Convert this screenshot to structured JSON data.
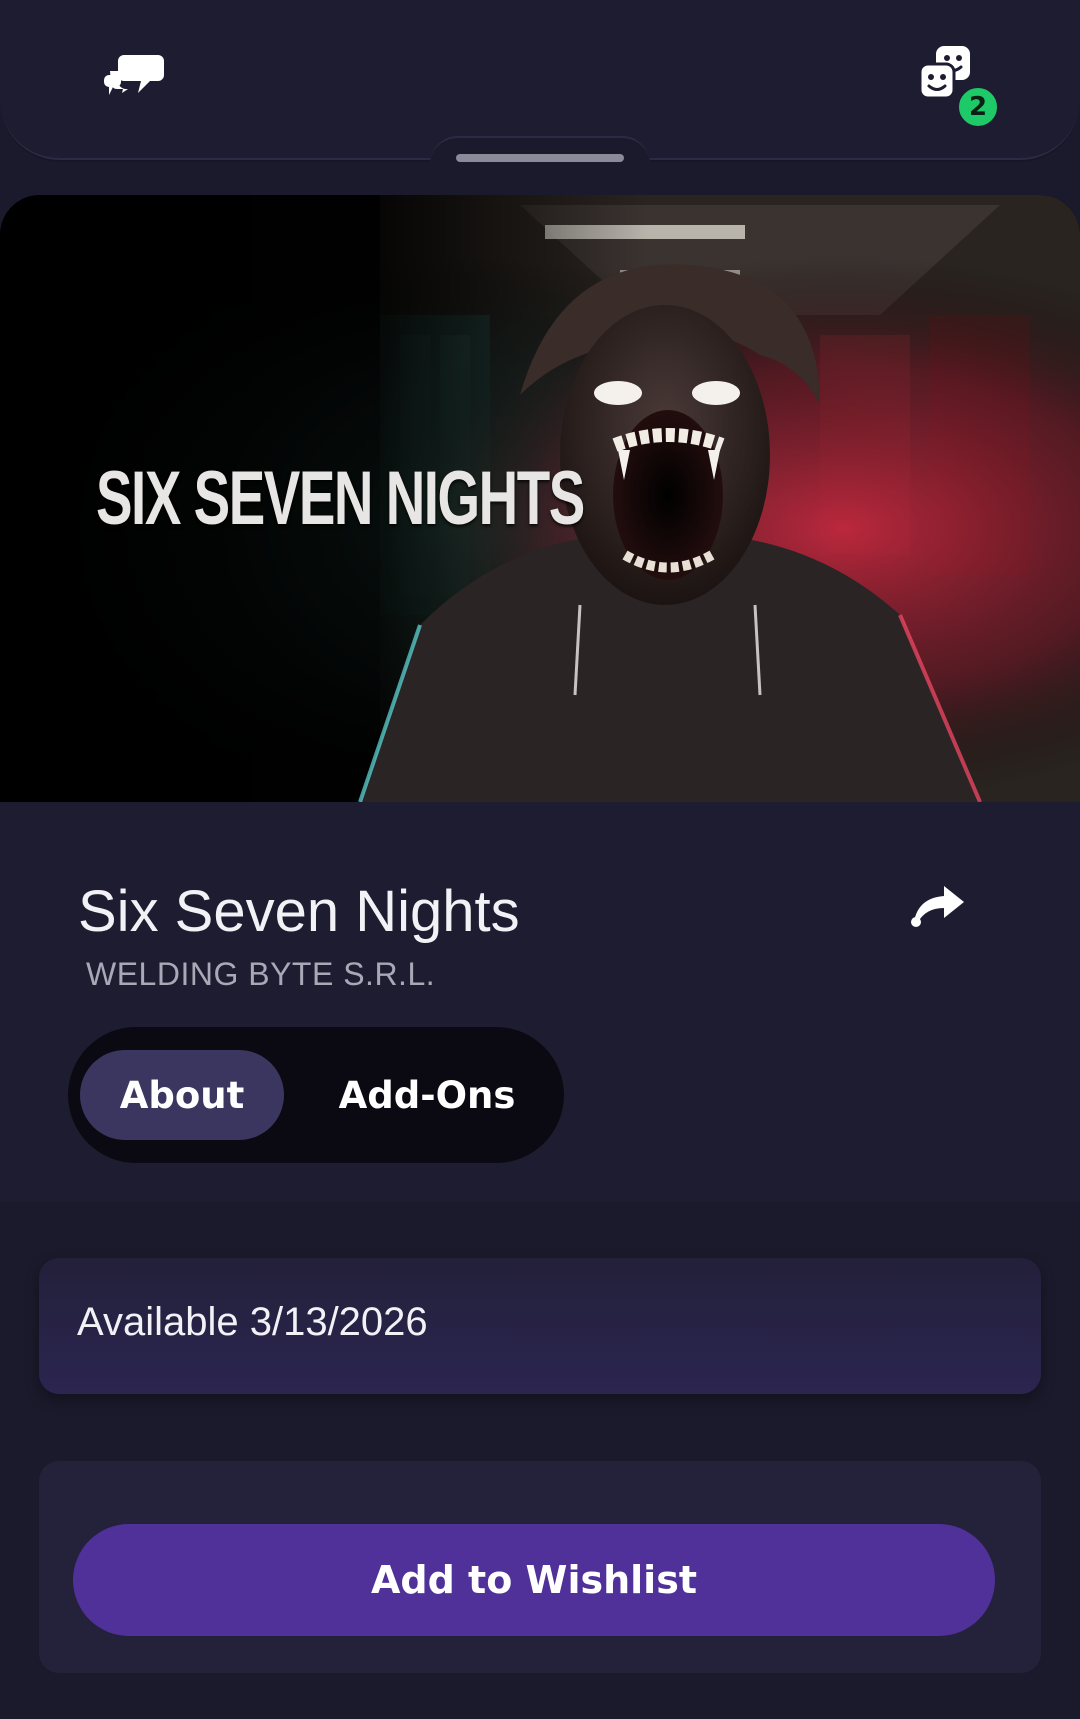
{
  "header": {
    "chat_icon": "chat-bubbles-icon",
    "friends_icon": "friends-icon",
    "friends_badge": "2"
  },
  "hero": {
    "title_art_text": "SIX SEVEN NIGHTS"
  },
  "game": {
    "title": "Six Seven Nights",
    "publisher": "WELDING BYTE S.R.L.",
    "share_icon": "share-arrow-icon"
  },
  "tabs": [
    {
      "label": "About",
      "selected": true
    },
    {
      "label": "Add-Ons",
      "selected": false
    }
  ],
  "availability": {
    "text": "Available 3/13/2026"
  },
  "wishlist": {
    "button_label": "Add to Wishlist"
  },
  "colors": {
    "background": "#1b1a2c",
    "accent": "#50319a",
    "tab_selected": "#3b365f",
    "badge": "#1ec968"
  }
}
